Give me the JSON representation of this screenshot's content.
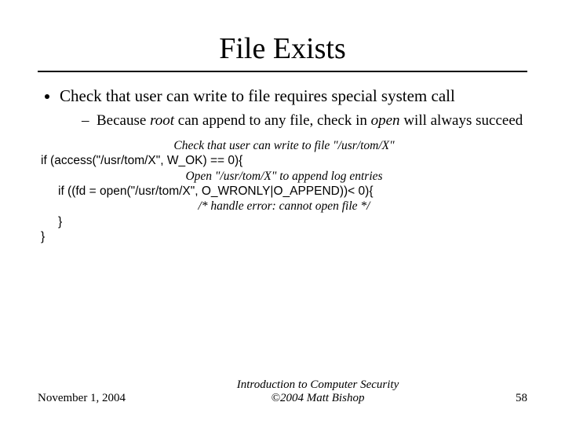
{
  "title": "File Exists",
  "bullet1": "Check that user can write to file requires special system call",
  "sub_before_root": "Because ",
  "sub_root": "root",
  "sub_mid": " can append to any file, check in ",
  "sub_open": "open",
  "sub_after": " will always succeed",
  "code": {
    "c1": "Check that user can write to file \"/usr/tom/X\"",
    "l1": "if (access(\"/usr/tom/X\", W_OK) == 0){",
    "c2": "Open \"/usr/tom/X\" to append log entries",
    "l2": "if ((fd = open(\"/usr/tom/X\", O_WRONLY|O_APPEND))< 0){",
    "c3": "/* handle error: cannot open file */",
    "l3": "}",
    "l4": "}"
  },
  "footer": {
    "date": "November 1, 2004",
    "line1": "Introduction to Computer Security",
    "line2": "©2004 Matt Bishop",
    "page": "58"
  }
}
